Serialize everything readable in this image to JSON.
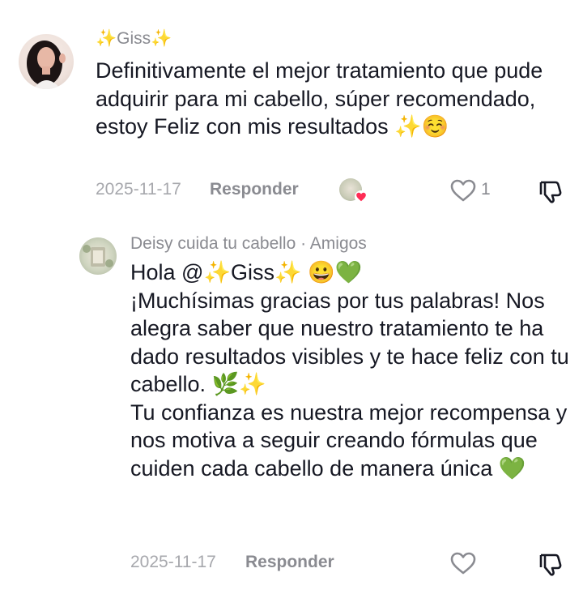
{
  "comments": [
    {
      "username": "✨Giss✨",
      "text": "Definitivamente el mejor tratamiento que pude adquirir para mi cabello, súper recomendado, estoy Feliz con mis resultados ✨☺️",
      "date": "2025-11-17",
      "reply_label": "Responder",
      "like_count": "1"
    },
    {
      "username": "Deisy cuida tu cabello · Amigos",
      "text": "Hola @✨Giss✨ 😀💚\n¡Muchísimas gracias por tus palabras! Nos alegra saber que nuestro tratamiento te ha dado resultados visibles y te hace feliz con tu cabello. 🌿✨\nTu confianza es nuestra mejor recompensa y nos motiva a seguir creando fórmulas que cuiden cada cabello de manera única 💚",
      "date": "2025-11-17",
      "reply_label": "Responder"
    }
  ],
  "colors": {
    "text": "#161823",
    "secondary": "#8a8b91",
    "date": "#a7a8ad",
    "liked_by_creator_heart": "#fe2c55"
  },
  "icons": [
    "heart-outline-icon",
    "thumbs-down-outline-icon",
    "creator-liked-heart-icon"
  ]
}
